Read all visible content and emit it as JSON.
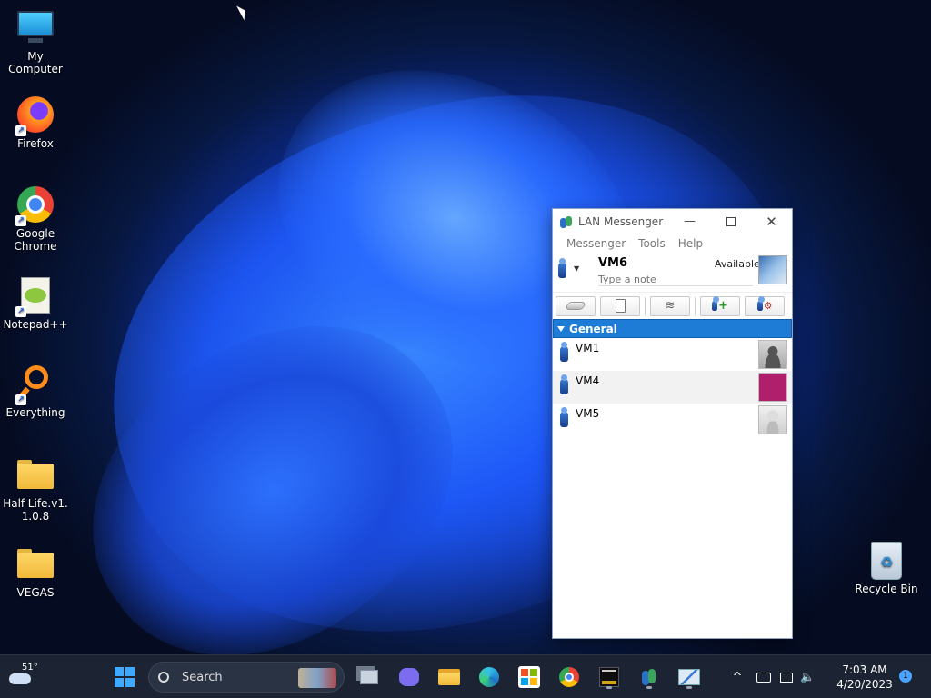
{
  "desktop": {
    "icons": [
      {
        "label": "My Computer",
        "icon": "monitor-icon"
      },
      {
        "label": "Firefox",
        "icon": "firefox-icon"
      },
      {
        "label": "Google Chrome",
        "icon": "chrome-icon"
      },
      {
        "label": "Notepad++",
        "icon": "notepadpp-icon"
      },
      {
        "label": "Everything",
        "icon": "search-lens-icon"
      },
      {
        "label": "Half-Life.v1.1.0.8",
        "icon": "folder-icon"
      },
      {
        "label": "VEGAS",
        "icon": "folder-icon"
      }
    ],
    "recycle_bin": "Recycle Bin"
  },
  "window": {
    "title": "LAN Messenger",
    "menu": [
      "Messenger",
      "Tools",
      "Help"
    ],
    "profile": {
      "name": "VM6",
      "status": "Available",
      "note_placeholder": "Type a note"
    },
    "toolbar": [
      "broadcast-icon",
      "file-transfer-icon",
      "rss-icon",
      "add-contact-icon",
      "contacts-settings-icon"
    ],
    "group": "General",
    "users": [
      {
        "name": "VM1",
        "avatar": "silhouette"
      },
      {
        "name": "VM4",
        "avatar": "striped-ball"
      },
      {
        "name": "VM5",
        "avatar": "robot"
      }
    ]
  },
  "taskbar": {
    "weather_temp": "51°",
    "search_label": "Search",
    "time": "7:03 AM",
    "date": "4/20/2023",
    "notification_count": "1",
    "pinned": [
      "task-view-icon",
      "teams-chat-icon",
      "file-explorer-icon",
      "edge-icon",
      "store-icon",
      "chrome-icon",
      "console-icon",
      "lan-messenger-icon",
      "resource-monitor-icon"
    ]
  },
  "colors": {
    "accent": "#1f7cd6",
    "taskbar": "#1c2433"
  }
}
